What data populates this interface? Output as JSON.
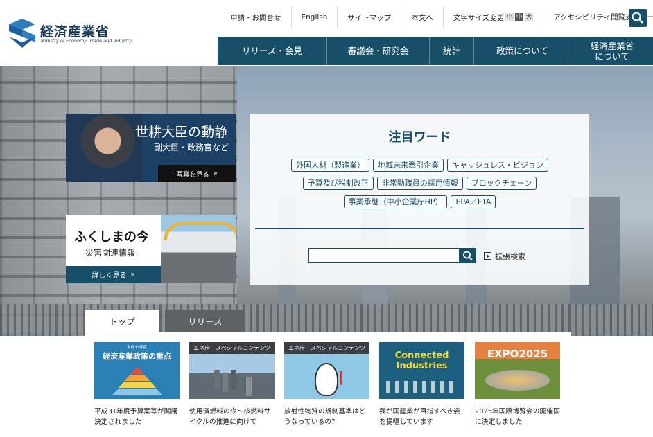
{
  "header": {
    "logo_jp": "経済産業省",
    "logo_en": "Ministry of Economy, Trade and Industry",
    "util": [
      "申請・お問合せ",
      "English",
      "サイトマップ",
      "本文へ"
    ],
    "fontsize_label": "文字サイズ変更",
    "fontsize_options": [
      "小",
      "中",
      "大"
    ],
    "accessibility": [
      "アクセシビリティ",
      "閲覧支援ツール"
    ],
    "search_icon": "search-icon"
  },
  "gnav": [
    "リリース・会見",
    "審議会・研究会",
    "統計",
    "政策について",
    "経済産業省\nについて"
  ],
  "hero": {
    "minister": {
      "title": "世耕大臣の動静",
      "sub": "副大臣・政務官など",
      "button": "写真を見る"
    },
    "fukushima": {
      "title": "ふくしまの今",
      "sub": "災害関連情報",
      "button": "詳しく見る"
    },
    "keywords": {
      "title": "注目ワード",
      "row1": [
        "外国人材（製造業）",
        "地域未来牽引企業",
        "キャッシュレス・ビジョン"
      ],
      "row2": [
        "予算及び税制改正",
        "非常勤職員の採用情報",
        "ブロックチェーン"
      ],
      "row3": [
        "事業承継（中小企業庁HP）",
        "EPA／FTA"
      ]
    },
    "advanced_search": "拡張検索"
  },
  "tabs": [
    "トップ",
    "リリース"
  ],
  "cards": [
    {
      "thumb_sub": "平成31年度",
      "thumb_title": "経済産業政策の重点",
      "text": "平成31年度予算案等が閣議決定されました"
    },
    {
      "thumb_head": "エネ庁　スペシャルコンテンツ",
      "text": "使用済燃料の今〜核燃料サイクルの推進に向けて"
    },
    {
      "thumb_head": "エネ庁　スペシャルコンテンツ",
      "text": "放射性物質の規制基準はどうなっているの？"
    },
    {
      "thumb_title": "Connected Industries",
      "text": "我が国産業が目指すべき姿を提唱しています"
    },
    {
      "thumb_title": "EXPO2025",
      "text": "2025年国際博覧会の開催国に決定しました"
    }
  ],
  "colors": {
    "brand": "#174e68",
    "brand_dark": "#1c3f64",
    "tab_inactive": "#5e6064"
  }
}
